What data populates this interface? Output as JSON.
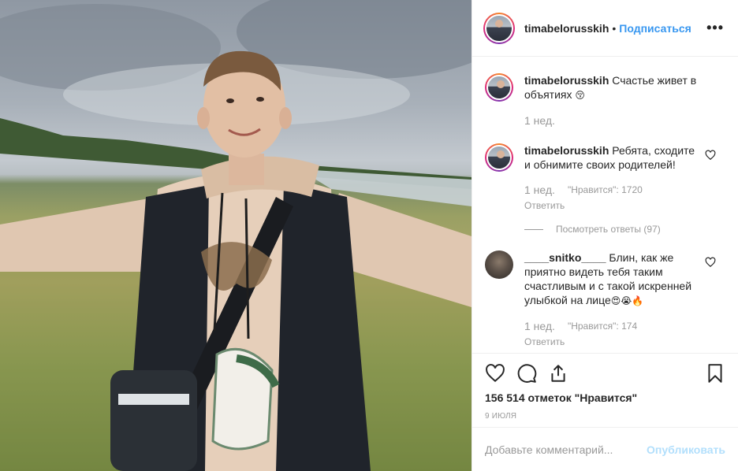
{
  "post": {
    "username": "timabelorusskih",
    "separator": "•",
    "follow_label": "Подписаться",
    "more_icon": "•••"
  },
  "comments": [
    {
      "username": "timabelorusskih",
      "text": "Счастье живет в объятиях",
      "emoji": "😚",
      "time": "1 нед."
    },
    {
      "username": "timabelorusskih",
      "text": "Ребята, сходите и обнимите своих родителей!",
      "time": "1 нед.",
      "likes": "\"Нравится\": 1720",
      "reply_label": "Ответить",
      "view_replies": "Посмотреть ответы (97)"
    },
    {
      "username": "____snitko____",
      "text": "Блин, как же приятно видеть тебя таким счастливым и с такой искренней улыбкой на лице",
      "emoji": "😍😭🔥",
      "time": "1 нед.",
      "likes": "\"Нравится\": 174",
      "reply_label": "Ответить"
    }
  ],
  "actions": {
    "like_icon": "heart-icon",
    "comment_icon": "comment-icon",
    "share_icon": "share-icon",
    "save_icon": "bookmark-icon",
    "likes_count": "156 514 отметок \"Нравится\"",
    "date": "9 ИЮЛЯ"
  },
  "add_comment": {
    "placeholder": "Добавьте комментарий...",
    "publish_label": "Опубликовать"
  },
  "colors": {
    "link_blue": "#3897f0",
    "publish_disabled": "#b2dffc",
    "muted": "#999999",
    "border": "#efefef"
  }
}
